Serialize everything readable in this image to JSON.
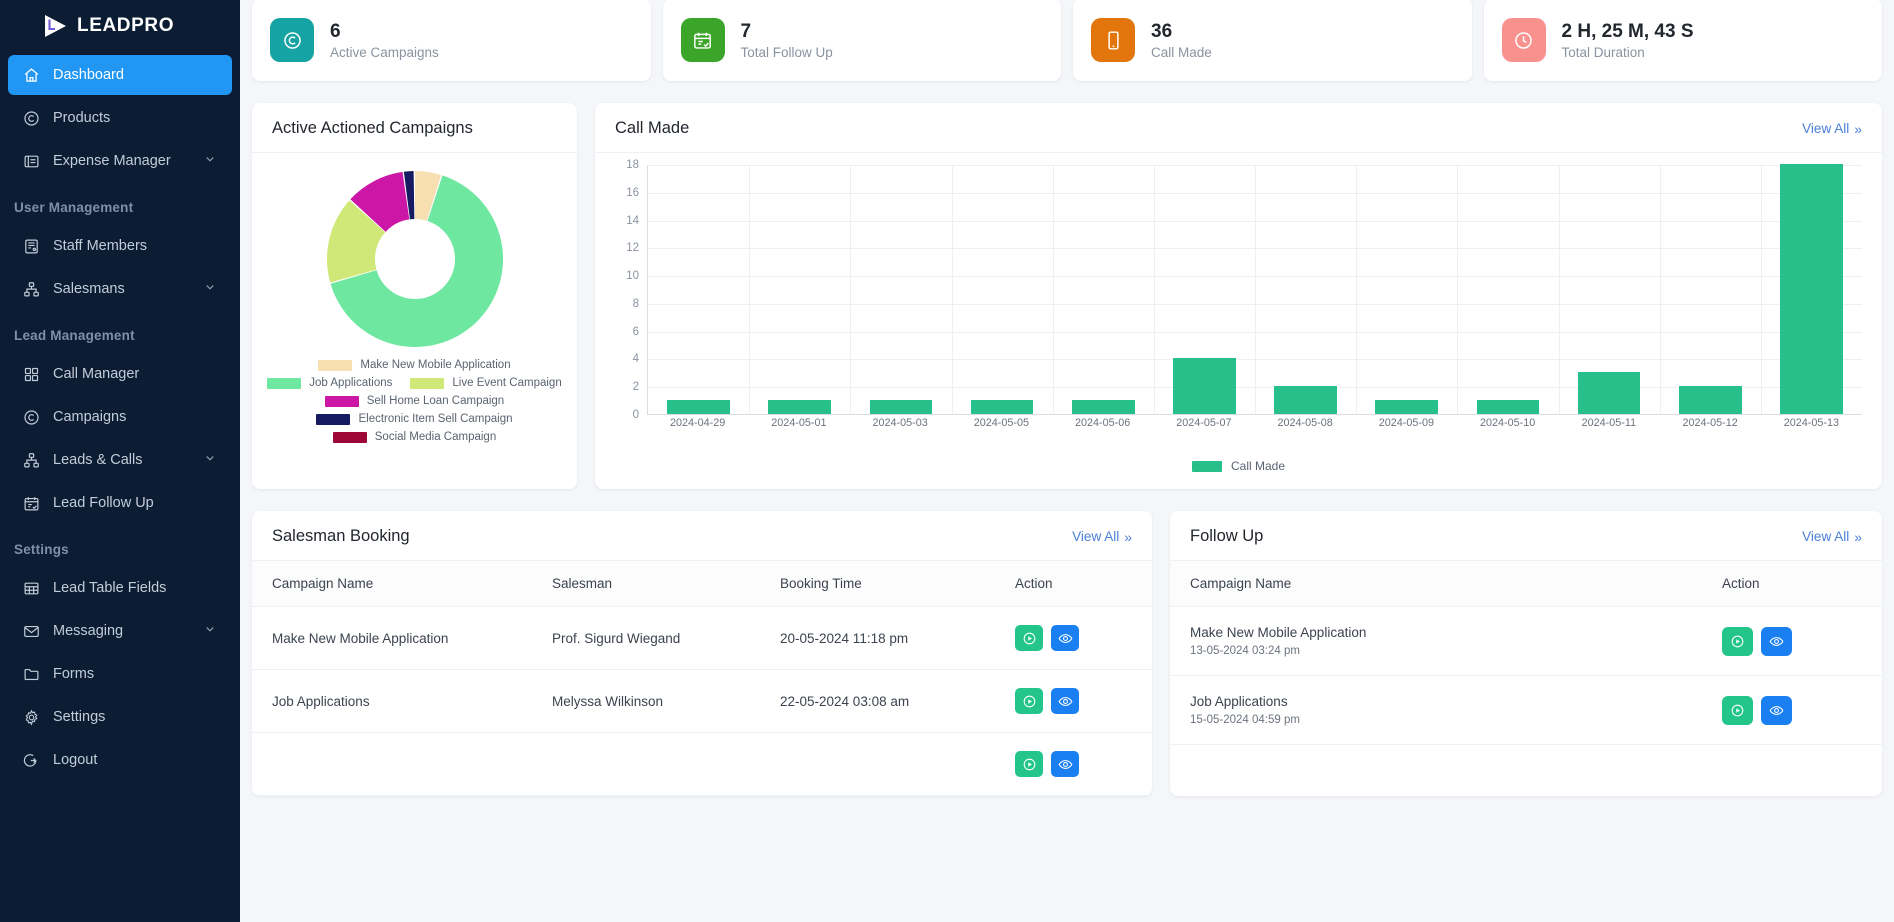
{
  "brand": {
    "name": "LEADPRO",
    "logo_icon": "play-logo-icon"
  },
  "sidebar": {
    "items": [
      {
        "label": "Dashboard",
        "icon": "home-icon",
        "active": true,
        "caret": false
      },
      {
        "label": "Products",
        "icon": "copyright-circle-icon",
        "active": false,
        "caret": false
      },
      {
        "label": "Expense Manager",
        "icon": "card-list-icon",
        "active": false,
        "caret": true
      }
    ],
    "sections": [
      {
        "title": "User Management",
        "items": [
          {
            "label": "Staff Members",
            "icon": "staff-badge-icon",
            "caret": false
          },
          {
            "label": "Salesmans",
            "icon": "org-tree-icon",
            "caret": true
          }
        ]
      },
      {
        "title": "Lead Management",
        "items": [
          {
            "label": "Call Manager",
            "icon": "grid-icon",
            "caret": false
          },
          {
            "label": "Campaigns",
            "icon": "copyright-circle-icon",
            "caret": false
          },
          {
            "label": "Leads & Calls",
            "icon": "org-tree-icon",
            "caret": true
          },
          {
            "label": "Lead Follow Up",
            "icon": "calendar-check-icon",
            "caret": false
          }
        ]
      },
      {
        "title": "Settings",
        "items": [
          {
            "label": "Lead Table Fields",
            "icon": "table-icon",
            "caret": false
          },
          {
            "label": "Messaging",
            "icon": "envelope-icon",
            "caret": true
          },
          {
            "label": "Forms",
            "icon": "folder-icon",
            "caret": false
          },
          {
            "label": "Settings",
            "icon": "gear-icon",
            "caret": false
          },
          {
            "label": "Logout",
            "icon": "logout-icon",
            "caret": false
          }
        ]
      }
    ]
  },
  "stats": [
    {
      "value": "6",
      "label": "Active Campaigns",
      "icon": "copyright-circle-icon",
      "color": "#16a3a3"
    },
    {
      "value": "7",
      "label": "Total Follow Up",
      "icon": "calendar-check-icon",
      "color": "#3aa528"
    },
    {
      "value": "36",
      "label": "Call Made",
      "icon": "mobile-phone-icon",
      "color": "#e2760c"
    },
    {
      "value": "2 H, 25 M, 43 S",
      "label": "Total Duration",
      "icon": "clock-icon",
      "color": "#f9918f"
    }
  ],
  "donut_card": {
    "title": "Active Actioned Campaigns"
  },
  "call_card": {
    "title": "Call Made",
    "view_all": "View All"
  },
  "chart_data": [
    {
      "type": "pie",
      "title": "Active Actioned Campaigns",
      "legend_position": "bottom",
      "labels": [
        "Make New Mobile Application",
        "Job Applications",
        "Live Event Campaign",
        "Sell Home Loan Campaign",
        "Electronic Item Sell Campaign",
        "Social Media Campaign"
      ],
      "values": [
        5,
        65,
        16,
        11,
        2,
        0
      ],
      "colors": [
        "#f7dfb2",
        "#6ee7a0",
        "#cfe877",
        "#cc17a6",
        "#161a60",
        "#9c0737"
      ]
    },
    {
      "type": "bar",
      "title": "Call Made",
      "xlabel": "",
      "ylabel": "",
      "ylim": [
        0,
        18
      ],
      "yticks": [
        0,
        2,
        4,
        6,
        8,
        10,
        12,
        14,
        16,
        18
      ],
      "grid": true,
      "legend": [
        "Call Made"
      ],
      "legend_position": "bottom",
      "series_color": "#27c08a",
      "categories": [
        "2024-04-29",
        "2024-05-01",
        "2024-05-03",
        "2024-05-05",
        "2024-05-06",
        "2024-05-07",
        "2024-05-08",
        "2024-05-09",
        "2024-05-10",
        "2024-05-11",
        "2024-05-12",
        "2024-05-13"
      ],
      "series": [
        {
          "name": "Call Made",
          "values": [
            1,
            1,
            1,
            1,
            1,
            4,
            2,
            1,
            1,
            3,
            2,
            18
          ]
        }
      ]
    }
  ],
  "booking": {
    "title": "Salesman Booking",
    "view_all": "View All",
    "columns": [
      "Campaign Name",
      "Salesman",
      "Booking Time",
      "Action"
    ],
    "rows": [
      {
        "campaign": "Make New Mobile Application",
        "salesman": "Prof. Sigurd Wiegand",
        "time": "20-05-2024 11:18 pm"
      },
      {
        "campaign": "Job Applications",
        "salesman": "Melyssa Wilkinson",
        "time": "22-05-2024 03:08 am"
      }
    ]
  },
  "followup": {
    "title": "Follow Up",
    "view_all": "View All",
    "columns": [
      "Campaign Name",
      "Action"
    ],
    "rows": [
      {
        "campaign": "Make New Mobile Application",
        "time": "13-05-2024 03:24 pm"
      },
      {
        "campaign": "Job Applications",
        "time": "15-05-2024 04:59 pm"
      }
    ]
  },
  "actions": {
    "play_icon": "play-circle-icon",
    "view_icon": "eye-icon"
  }
}
